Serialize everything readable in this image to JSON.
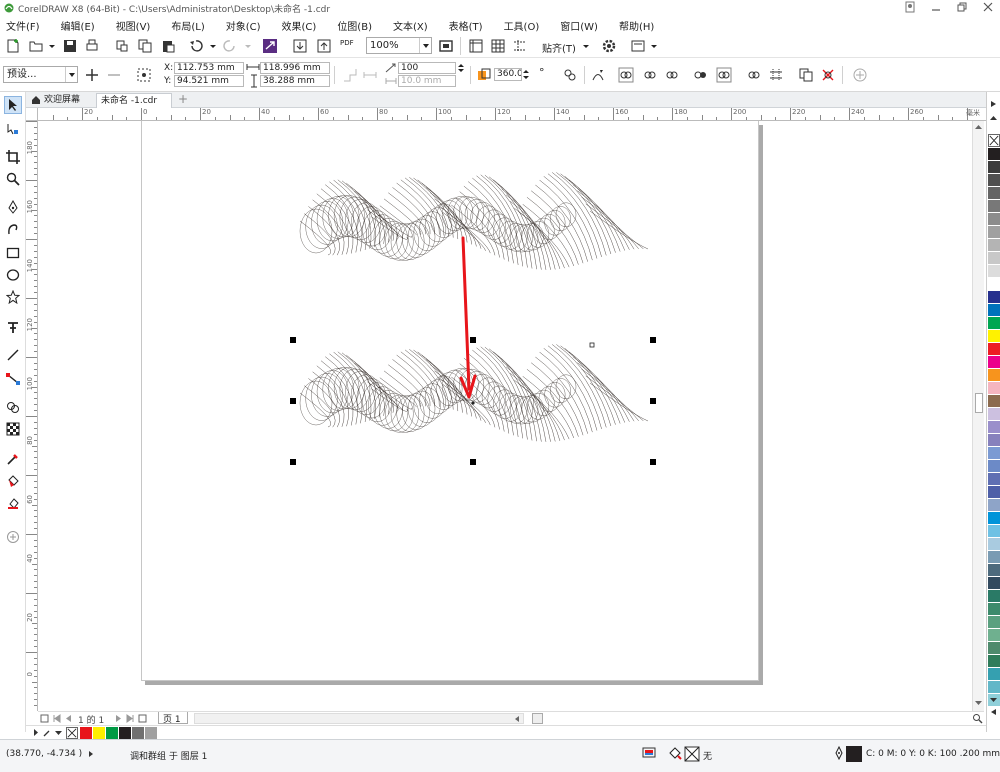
{
  "window": {
    "title": "CorelDRAW X8 (64-Bit) - C:\\Users\\Administrator\\Desktop\\未命名 -1.cdr"
  },
  "menu": [
    "文件(F)",
    "编辑(E)",
    "视图(V)",
    "布局(L)",
    "对象(C)",
    "效果(C)",
    "位图(B)",
    "文本(X)",
    "表格(T)",
    "工具(O)",
    "窗口(W)",
    "帮助(H)"
  ],
  "toolbar": {
    "zoom": "100%",
    "snap_label": "贴齐(T)",
    "pdf_label": "PDF"
  },
  "property_bar": {
    "preset": "预设...",
    "x_label": "X:",
    "x_value": "112.753 mm",
    "y_label": "Y:",
    "y_value": "94.521 mm",
    "width_value": "118.996 mm",
    "height_value": "38.288 mm",
    "steps_value": "100",
    "spacing_value": "10.0 mm",
    "angle_value": "360.0",
    "angle_unit": "°"
  },
  "tabs": {
    "welcome": "欢迎屏幕",
    "document": "未命名 -1.cdr",
    "add": "+"
  },
  "ruler": {
    "h_labels": [
      "20",
      "0",
      "20",
      "40",
      "60",
      "80",
      "100",
      "120",
      "140",
      "160",
      "180",
      "200",
      "220",
      "240",
      "260"
    ],
    "unit": "毫米",
    "v_labels": [
      "180",
      "160",
      "140",
      "120",
      "100",
      "80",
      "60",
      "40",
      "20",
      "0"
    ]
  },
  "page_nav": {
    "page_of": "1 的 1",
    "page_tab": "页 1"
  },
  "status": {
    "coords": "(38.770, -4.734 )",
    "selection_info": "调和群组 于 图层 1",
    "fill_none": "无",
    "outline_info": "C: 0 M: 0 Y: 0 K: 100  .200 mm"
  },
  "colors": {
    "accent_blue": "#2a7ad6",
    "arrow_red": "#e8151b",
    "artwork": "#2a221e"
  },
  "palette_colors": [
    "#e8151b",
    "#ffef00",
    "#009a44",
    "#231f20",
    "#707070",
    "#a0a0a0"
  ],
  "right_palette_colors": [
    "#231f20",
    "#3c3c3c",
    "#505050",
    "#646464",
    "#787878",
    "#8c8c8c",
    "#a0a0a0",
    "#b4b4b4",
    "#c8c8c8",
    "#dcdcdc",
    "#ffffff",
    "#26308e",
    "#0072bc",
    "#00a651",
    "#fff200",
    "#ed1c24",
    "#ec008c",
    "#f7941d",
    "#f5b5c0",
    "#8c6b4f",
    "#ccc0e0",
    "#9a8fcb",
    "#8781bd",
    "#7b9ad3",
    "#6c8ac7",
    "#5f6fb3",
    "#4e5fa8",
    "#8ea4c8",
    "#0094d9",
    "#6ec1e4",
    "#a9cbe0",
    "#7a9bb3",
    "#4d6a7d",
    "#324a5f",
    "#2a7a66",
    "#3d8b6c",
    "#5aa07f",
    "#6fb08f",
    "#4e8a6c",
    "#2f7c5a",
    "#35a0b0",
    "#62b7c8",
    "#8fcfd9"
  ]
}
